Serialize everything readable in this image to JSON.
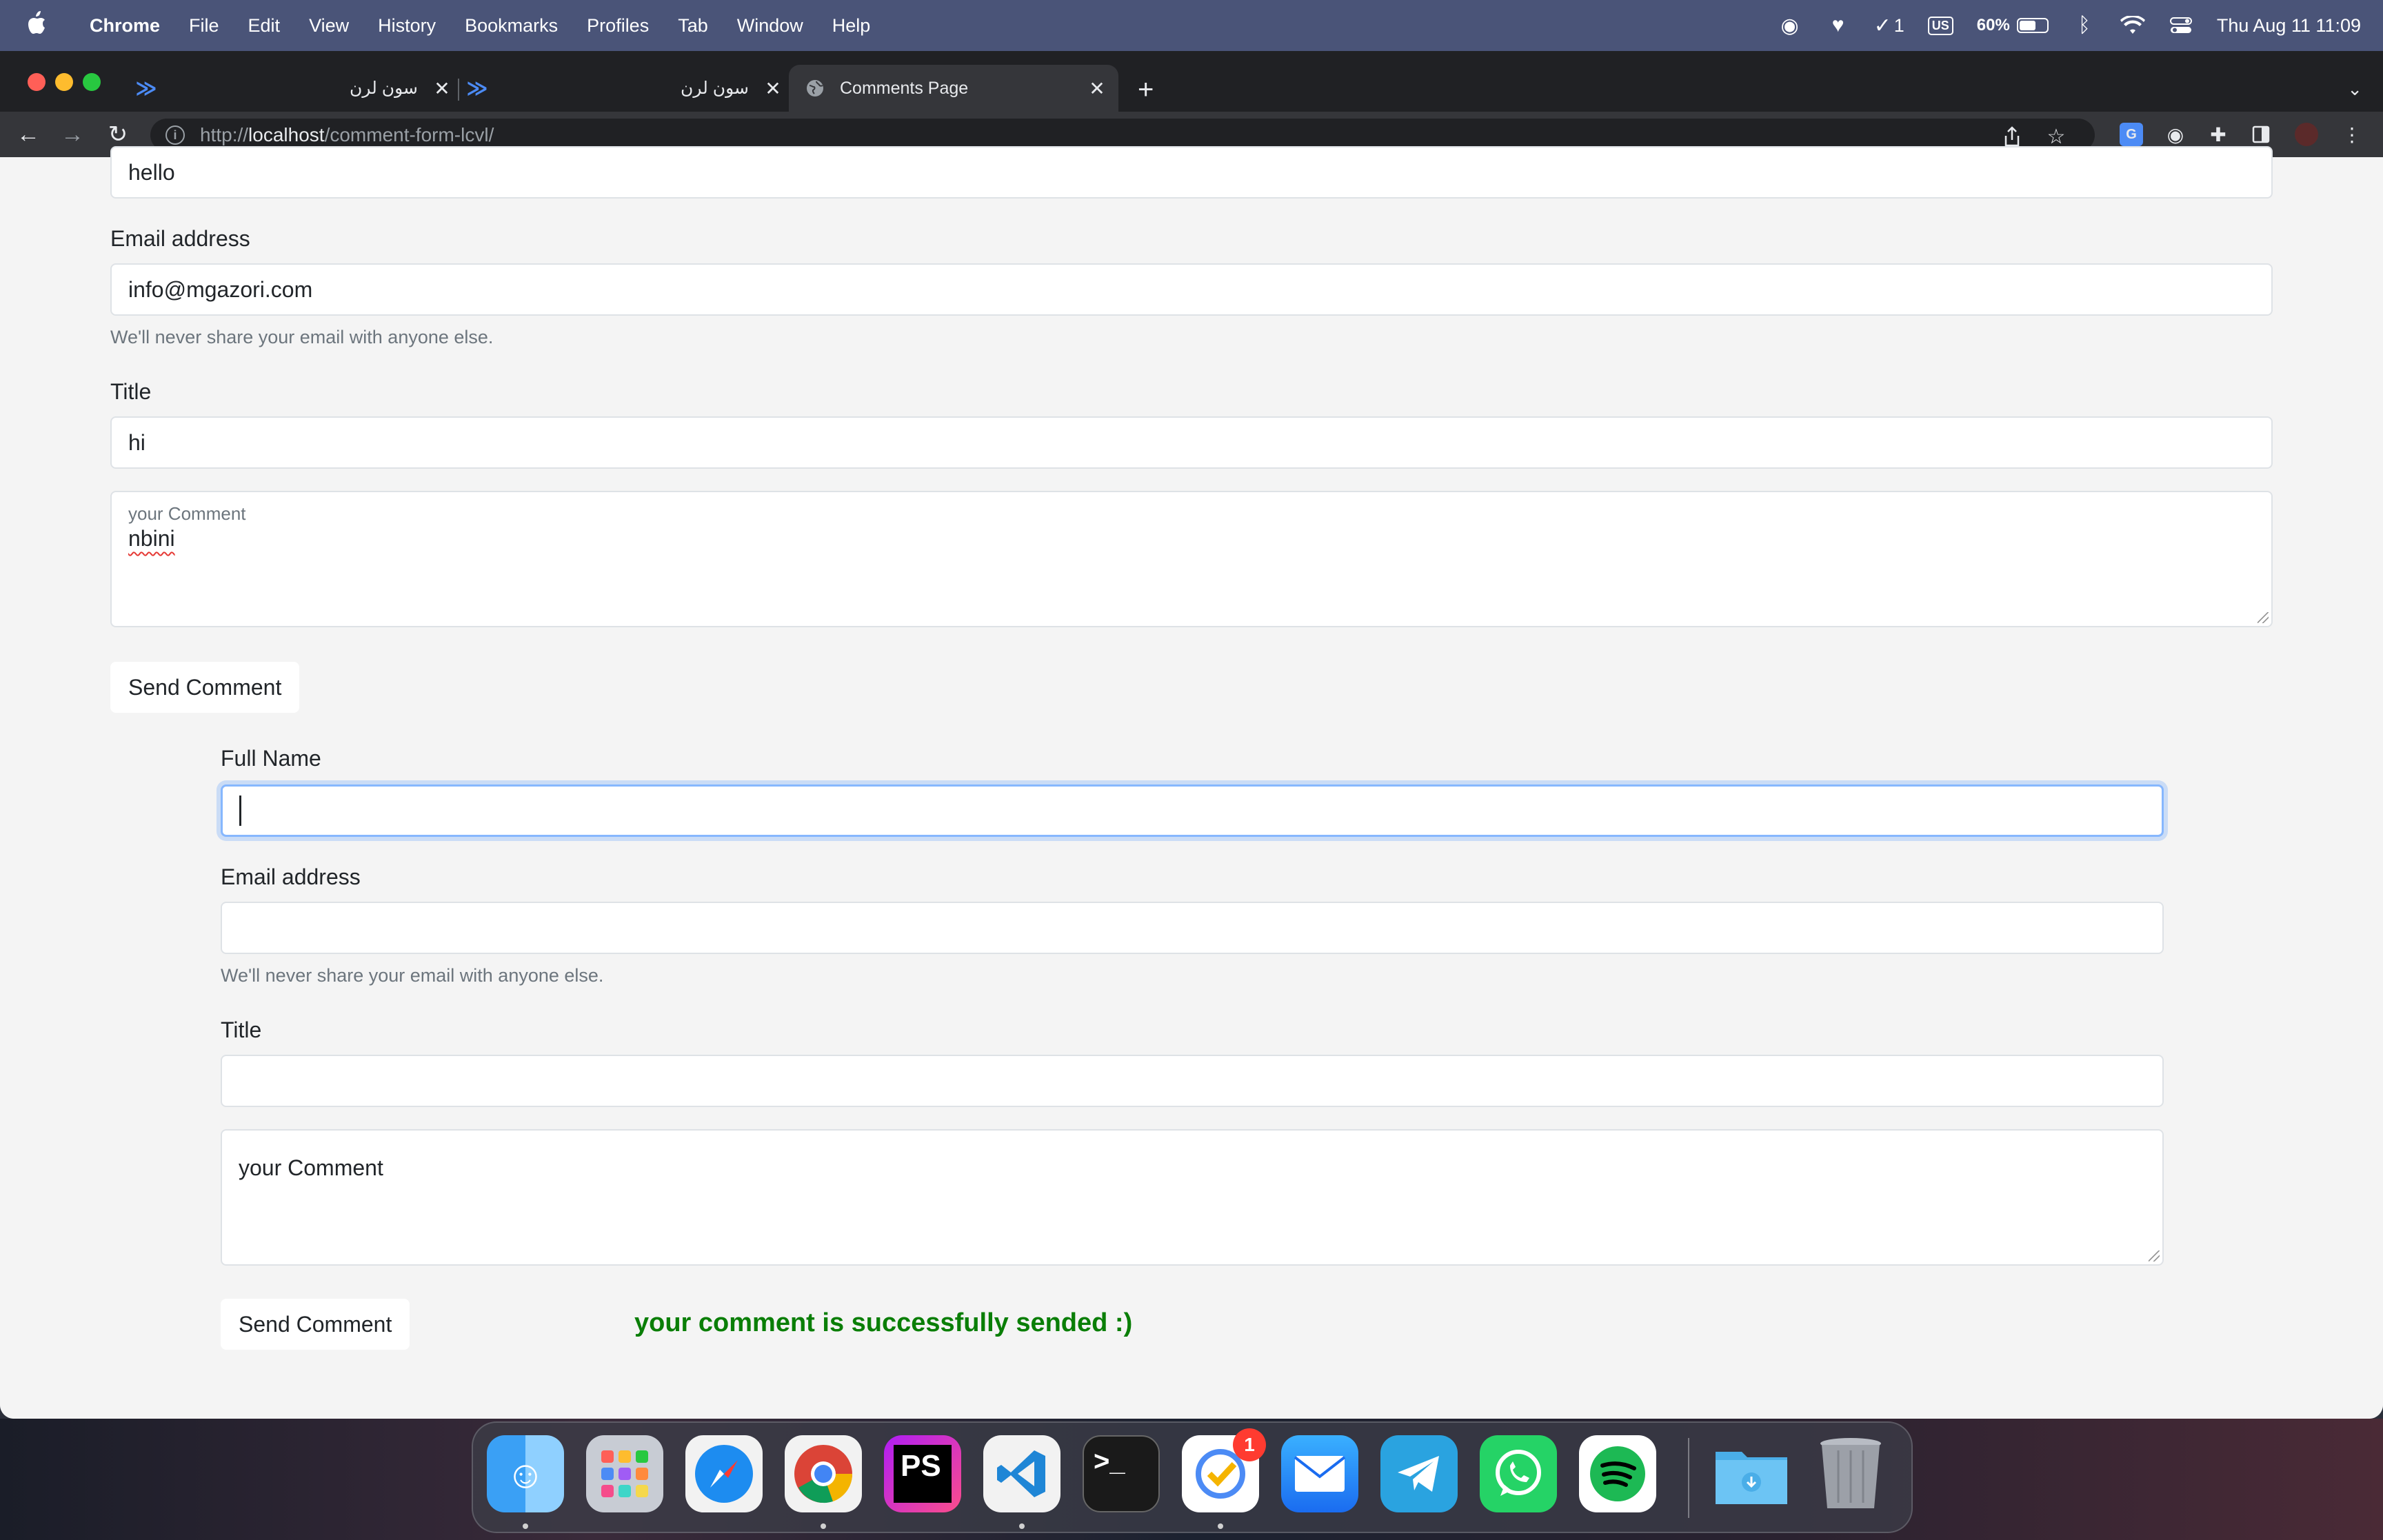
{
  "menubar": {
    "app_name": "Chrome",
    "items": [
      "File",
      "Edit",
      "View",
      "History",
      "Bookmarks",
      "Profiles",
      "Tab",
      "Window",
      "Help"
    ],
    "status_badge_count": "1",
    "keyboard_layout": "US",
    "battery_percent": "60%",
    "battery_level": 0.6,
    "clock": "Thu Aug 11  11:09"
  },
  "browser": {
    "tabs": [
      {
        "title": "سون لرن",
        "favicon": "sonlearn-logo-icon"
      },
      {
        "title": "سون لرن",
        "favicon": "sonlearn-logo-icon"
      },
      {
        "title": "Comments Page",
        "favicon": "globe-icon"
      }
    ],
    "address": {
      "scheme": "http://",
      "host": "localhost",
      "path": "/comment-form-lcvl/"
    }
  },
  "form1": {
    "name_value": "hello",
    "email_label": "Email address",
    "email_value": "info@mgazori.com",
    "email_help": "We'll never share your email with anyone else.",
    "title_label": "Title",
    "title_value": "hi",
    "comment_label": "your Comment",
    "comment_value": "nbini",
    "submit_label": "Send Comment"
  },
  "form2": {
    "name_label": "Full Name",
    "name_value": "",
    "email_label": "Email address",
    "email_value": "",
    "email_help": "We'll never share your email with anyone else.",
    "title_label": "Title",
    "title_value": "",
    "comment_placeholder": "your Comment",
    "submit_label": "Send Comment",
    "success_message": "your comment is successfully sended :)"
  },
  "dock": {
    "apps": [
      "finder-icon",
      "launchpad-icon",
      "safari-icon",
      "chrome-icon",
      "phpstorm-icon",
      "vscode-icon",
      "terminal-icon",
      "tasks-icon",
      "mail-icon",
      "telegram-icon",
      "whatsapp-icon",
      "spotify-icon",
      "downloads-folder-icon",
      "trash-icon"
    ],
    "phpstorm_label": "PS",
    "tasks_badge": "1"
  },
  "colors": {
    "success": "#0a7e07",
    "focus_ring": "#86b7fe",
    "menubar": "#4a5478"
  }
}
